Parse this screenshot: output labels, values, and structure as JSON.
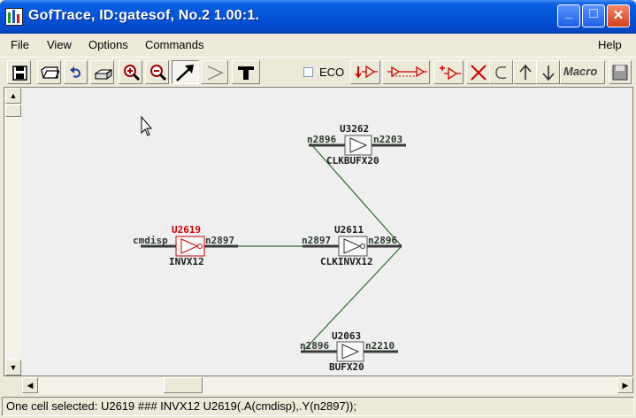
{
  "window": {
    "title": "GofTrace, ID:gatesof, No.2 1.00:1.",
    "controls": {
      "minimize": "_",
      "maximize": "□",
      "close": "✕"
    }
  },
  "menu": {
    "items": [
      "File",
      "View",
      "Options",
      "Commands"
    ],
    "help": "Help"
  },
  "toolbar": {
    "tools": [
      {
        "icon": "save-icon"
      },
      {
        "icon": "open-folder-icon"
      },
      {
        "icon": "undo-icon"
      },
      {
        "icon": "print-icon"
      },
      {
        "icon": "zoom-in-icon"
      },
      {
        "icon": "zoom-out-icon"
      },
      {
        "icon": "select-arrow-icon",
        "pressed": true
      },
      {
        "icon": "trace-arrow-icon"
      },
      {
        "icon": "text-tool-icon"
      }
    ],
    "eco_label": "ECO",
    "eco_checked": false,
    "macro_label": "Macro"
  },
  "schematic": {
    "cells": [
      {
        "id": "U3262",
        "type": "CLKBUFX20",
        "in_net": "n2896",
        "out_net": "n2203",
        "selected": false
      },
      {
        "id": "U2619",
        "type": "INVX12",
        "in_net": "cmdisp",
        "out_net": "n2897",
        "selected": true
      },
      {
        "id": "U2611",
        "type": "CLKINVX12",
        "in_net": "n2897",
        "out_net": "n2896",
        "selected": false
      },
      {
        "id": "U2063",
        "type": "BUFX20",
        "in_net": "n2896",
        "out_net": "n2210",
        "selected": false
      }
    ],
    "colors": {
      "wire": "#2f6b2f",
      "pin": "#3a3a3a",
      "label": "#1a1a1a",
      "selected": "#cc0000",
      "net_label": "#2a3a2a"
    }
  },
  "status": {
    "text": "One cell selected: U2619 ### INVX12 U2619(.A(cmdisp),.Y(n2897));"
  }
}
